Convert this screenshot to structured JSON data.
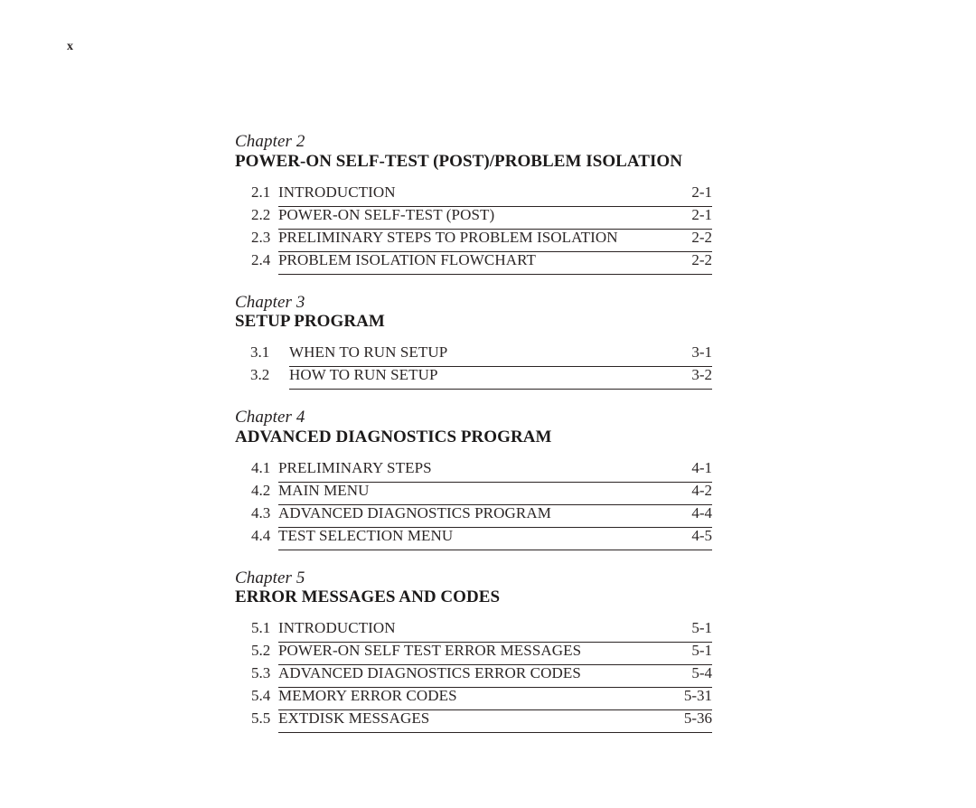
{
  "page": {
    "folio": "x",
    "background_color": "#ffffff",
    "text_color": "#231f20",
    "rule_color": "#2b2424"
  },
  "toc": {
    "chapters": [
      {
        "label": "Chapter 2",
        "title": "POWER-ON SELF-TEST (POST)/PROBLEM ISOLATION",
        "gutter": "narrow",
        "entries": [
          {
            "number": "2.1",
            "title": "INTRODUCTION",
            "page": "2-1"
          },
          {
            "number": "2.2",
            "title": "POWER-ON SELF-TEST (POST)",
            "page": "2-1"
          },
          {
            "number": "2.3",
            "title": "PRELIMINARY STEPS TO PROBLEM ISOLATION",
            "page": "2-2"
          },
          {
            "number": "2.4",
            "title": "PROBLEM ISOLATION FLOWCHART",
            "page": "2-2"
          }
        ]
      },
      {
        "label": "Chapter 3",
        "title": "SETUP PROGRAM",
        "gutter": "wide",
        "entries": [
          {
            "number": "3.1",
            "title": "WHEN TO RUN SETUP",
            "page": "3-1"
          },
          {
            "number": "3.2",
            "title": "HOW TO RUN SETUP",
            "page": "3-2"
          }
        ]
      },
      {
        "label": "Chapter 4",
        "title": "ADVANCED DIAGNOSTICS PROGRAM",
        "gutter": "narrow",
        "entries": [
          {
            "number": "4.1",
            "title": "PRELIMINARY STEPS",
            "page": "4-1"
          },
          {
            "number": "4.2",
            "title": "MAIN MENU",
            "page": "4-2"
          },
          {
            "number": "4.3",
            "title": "ADVANCED DIAGNOSTICS PROGRAM",
            "page": "4-4"
          },
          {
            "number": "4.4",
            "title": "TEST SELECTION MENU",
            "page": "4-5"
          }
        ]
      },
      {
        "label": "Chapter 5",
        "title": "ERROR MESSAGES AND CODES",
        "gutter": "narrow",
        "entries": [
          {
            "number": "5.1",
            "title": "INTRODUCTION",
            "page": "5-1"
          },
          {
            "number": "5.2",
            "title": "POWER-ON SELF TEST ERROR MESSAGES",
            "page": "5-1"
          },
          {
            "number": "5.3",
            "title": "ADVANCED DIAGNOSTICS ERROR CODES",
            "page": "5-4"
          },
          {
            "number": "5.4",
            "title": "MEMORY ERROR CODES",
            "page": "5-31"
          },
          {
            "number": "5.5",
            "title": "EXTDISK MESSAGES",
            "page": "5-36"
          }
        ]
      }
    ]
  }
}
